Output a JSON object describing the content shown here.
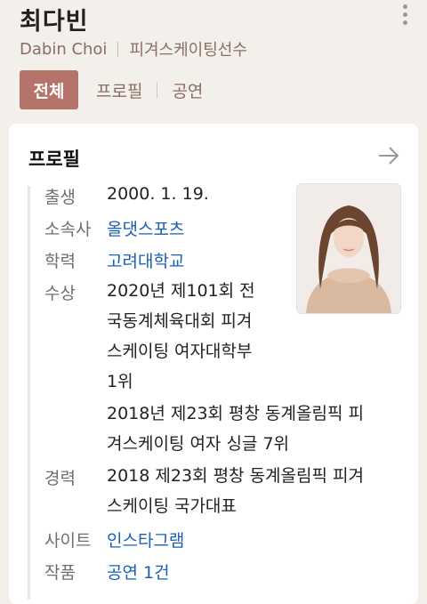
{
  "header": {
    "name": "최다빈",
    "english_name": "Dabin Choi",
    "occupation": "피겨스케이팅선수"
  },
  "tabs": [
    {
      "label": "전체",
      "active": true
    },
    {
      "label": "프로필",
      "active": false
    },
    {
      "label": "공연",
      "active": false
    }
  ],
  "profile": {
    "title": "프로필",
    "rows": {
      "birth": {
        "label": "출생",
        "value": "2000. 1. 19."
      },
      "agency": {
        "label": "소속사",
        "value": "올댓스포츠"
      },
      "education": {
        "label": "학력",
        "value": "고려대학교"
      },
      "awards": {
        "label": "수상",
        "lines": [
          "2020년 제101회 전",
          "국동계체육대회 피겨",
          "스케이팅 여자대학부",
          "1위",
          "2018년 제23회 평창 동계올림픽 피",
          "겨스케이팅 여자 싱글 7위"
        ]
      },
      "career": {
        "label": "경력",
        "lines": [
          "2018 제23회 평창 동계올림픽 피겨",
          "스케이팅 국가대표"
        ]
      },
      "site": {
        "label": "사이트",
        "value": "인스타그램"
      },
      "works": {
        "label": "작품",
        "value": "공연 1건"
      }
    }
  },
  "colors": {
    "accent": "#b5736a",
    "link": "#1a5fb4",
    "background": "#f3efeb"
  }
}
